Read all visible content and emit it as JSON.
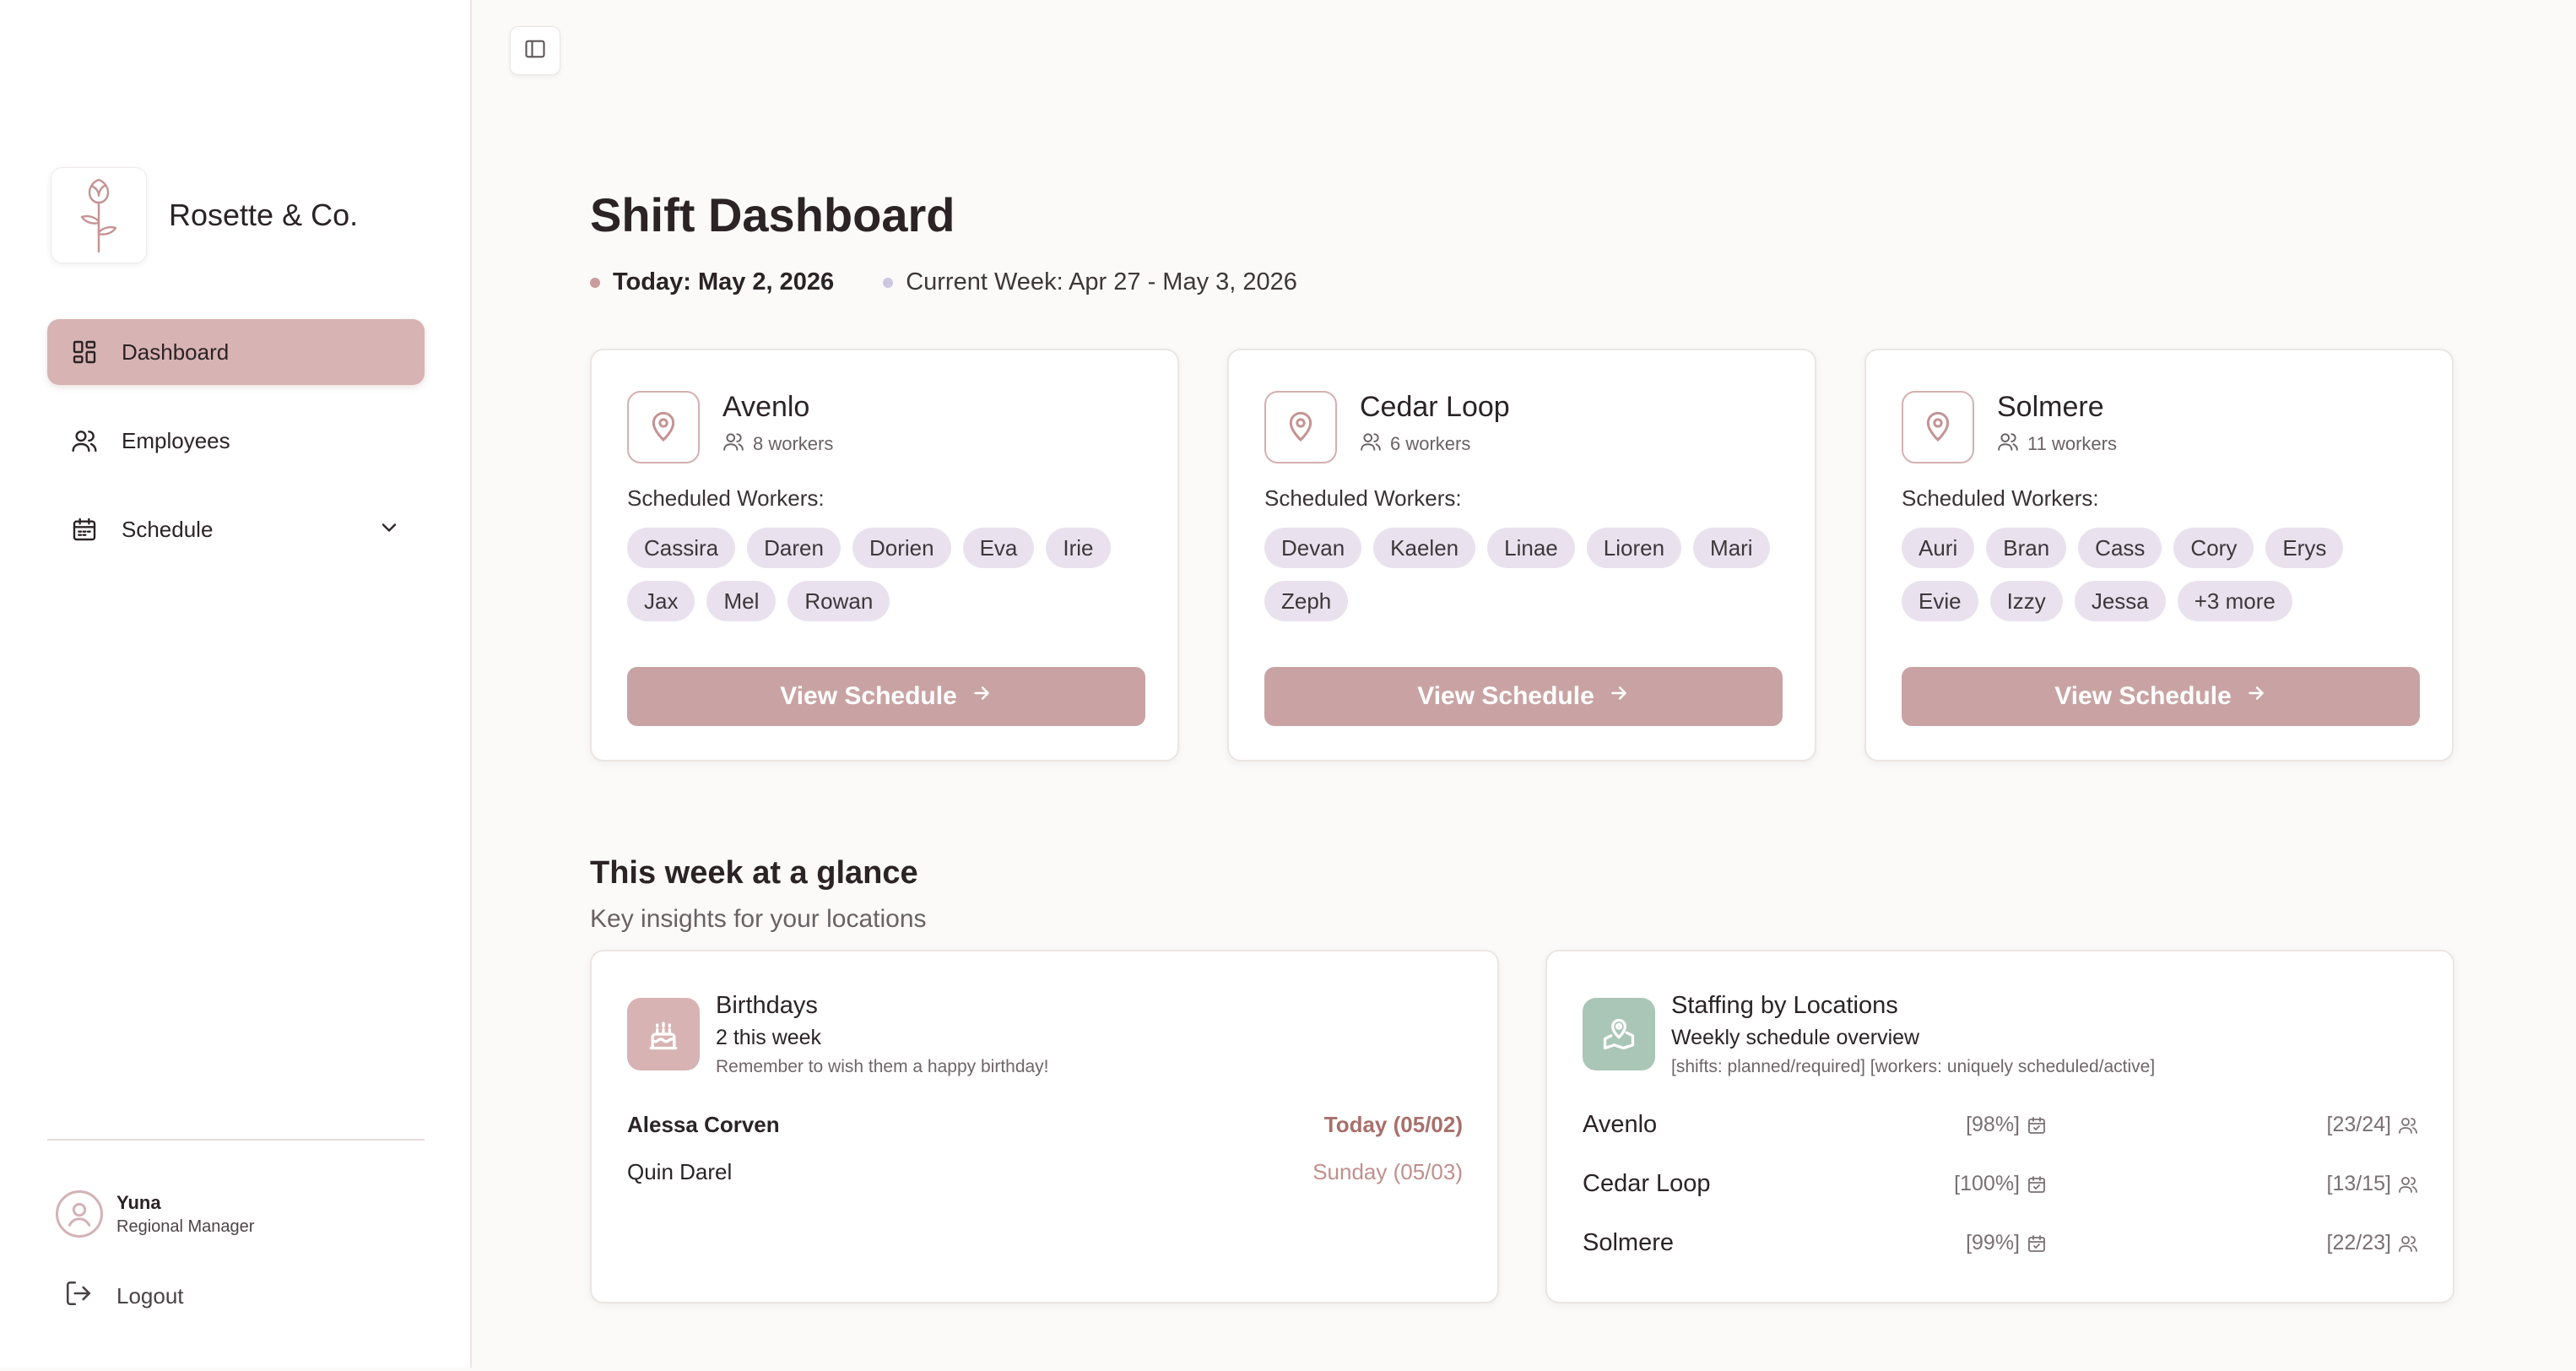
{
  "brand": {
    "name": "Rosette & Co."
  },
  "nav": {
    "items": [
      {
        "label": "Dashboard"
      },
      {
        "label": "Employees"
      },
      {
        "label": "Schedule"
      }
    ]
  },
  "user": {
    "name": "Yuna",
    "role": "Regional Manager",
    "logout_label": "Logout"
  },
  "header": {
    "title": "Shift Dashboard",
    "today": "Today: May 2, 2026",
    "current_week": "Current Week: Apr 27 - May 3, 2026"
  },
  "locations": [
    {
      "name": "Avenlo",
      "workers": "8 workers",
      "scheduled_label": "Scheduled Workers:",
      "chips": [
        "Cassira",
        "Daren",
        "Dorien",
        "Eva",
        "Irie",
        "Jax",
        "Mel",
        "Rowan"
      ],
      "button": "View Schedule"
    },
    {
      "name": "Cedar Loop",
      "workers": "6 workers",
      "scheduled_label": "Scheduled Workers:",
      "chips": [
        "Devan",
        "Kaelen",
        "Linae",
        "Lioren",
        "Mari",
        "Zeph"
      ],
      "button": "View Schedule"
    },
    {
      "name": "Solmere",
      "workers": "11 workers",
      "scheduled_label": "Scheduled Workers:",
      "chips": [
        "Auri",
        "Bran",
        "Cass",
        "Cory",
        "Erys",
        "Evie",
        "Izzy",
        "Jessa",
        "+3 more"
      ],
      "button": "View Schedule"
    }
  ],
  "glance": {
    "title": "This week at a glance",
    "subtitle": "Key insights for your locations",
    "birthdays": {
      "title": "Birthdays",
      "count": "2 this week",
      "note": "Remember to wish them a happy birthday!",
      "rows": [
        {
          "name": "Alessa Corven",
          "date": "Today (05/02)"
        },
        {
          "name": "Quin Darel",
          "date": "Sunday (05/03)"
        }
      ]
    },
    "staffing": {
      "title": "Staffing by Locations",
      "subtitle": "Weekly schedule overview",
      "note": "[shifts: planned/required] [workers: uniquely scheduled/active]",
      "rows": [
        {
          "name": "Avenlo",
          "shifts": "[98%]",
          "workers": "[23/24]"
        },
        {
          "name": "Cedar Loop",
          "shifts": "[100%]",
          "workers": "[13/15]"
        },
        {
          "name": "Solmere",
          "shifts": "[99%]",
          "workers": "[22/23]"
        }
      ]
    }
  },
  "colors": {
    "accent": "#c9a3a3",
    "nav_active": "#d8b3b3",
    "chip_bg": "#e9e2ee",
    "today_dot": "#c89c9c",
    "week_dot": "#cfc6e0",
    "birthday_today": "#a8706b",
    "birthday_other": "#c08f8c",
    "staffing_icon_bg": "#a9c6b6"
  },
  "icons": [
    "rose-logo-icon",
    "dashboard-icon",
    "users-icon",
    "calendar-icon",
    "chevron-down-icon",
    "user-circle-icon",
    "logout-icon",
    "sidebar-toggle-icon",
    "map-pin-icon",
    "arrow-right-icon",
    "cake-icon",
    "map-icon"
  ]
}
